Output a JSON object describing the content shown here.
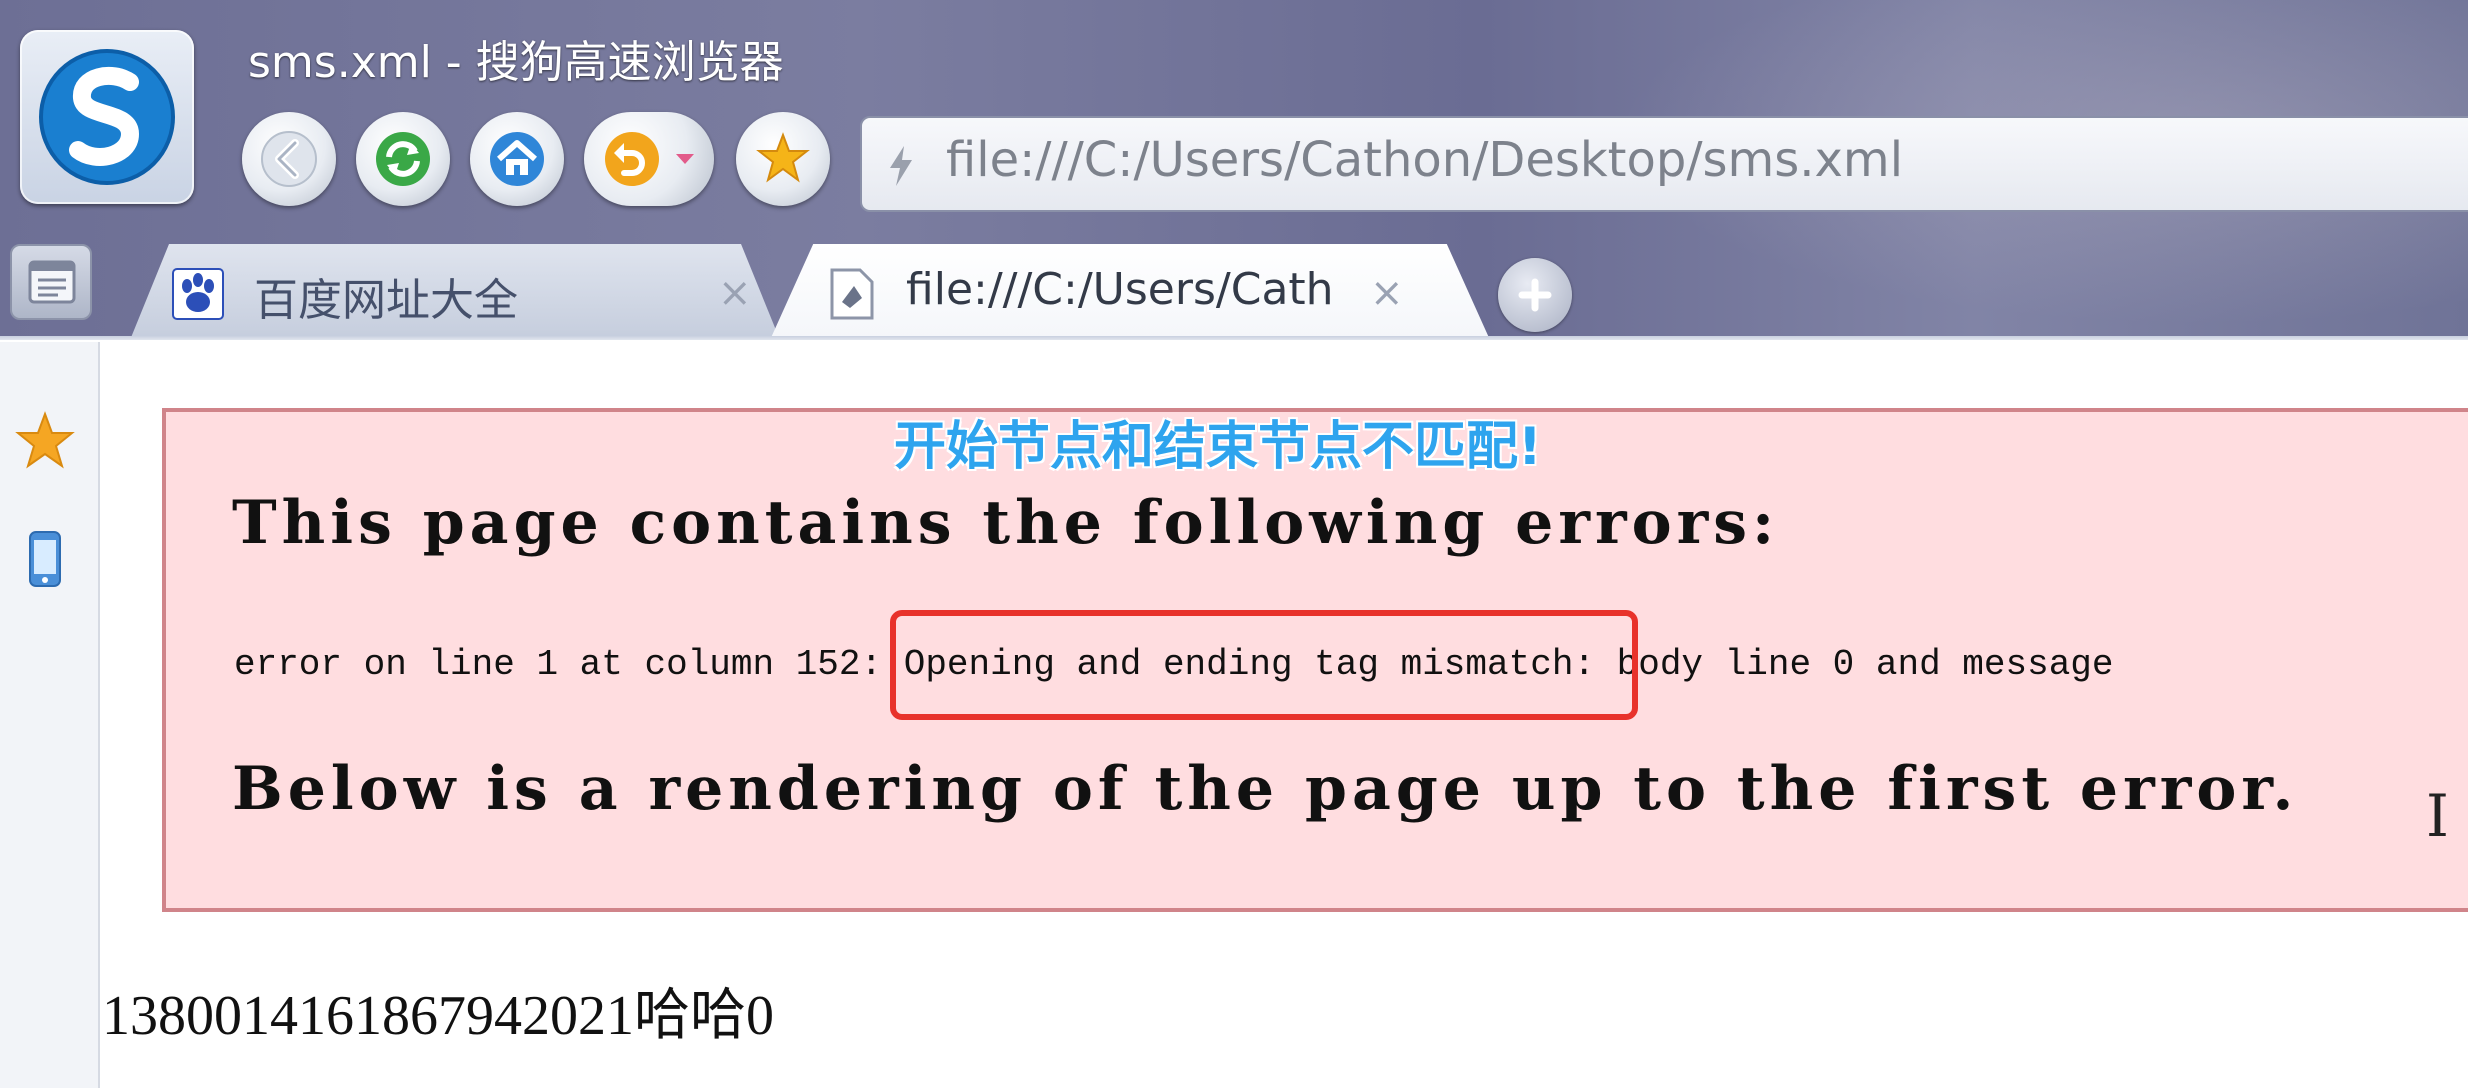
{
  "window": {
    "title": "sms.xml - 搜狗高速浏览器"
  },
  "toolbar": {
    "back_icon": "back-arrow-icon",
    "refresh_icon": "refresh-icon",
    "home_icon": "home-icon",
    "undo_icon": "undo-icon",
    "favorite_icon": "star-icon"
  },
  "address_bar": {
    "url": "file:///C:/Users/Cathon/Desktop/sms.xml"
  },
  "tabs": [
    {
      "label": "百度网址大全",
      "close": "×",
      "active": false
    },
    {
      "label": "file:///C:/Users/Cath",
      "close": "×",
      "active": true
    }
  ],
  "page": {
    "caption": "开始节点和结束节点不匹配!",
    "error_heading": "This page contains the following errors:",
    "error_message": "error on line 1 at column 152: Opening and ending tag mismatch: body line 0 and message",
    "render_heading": "Below is a rendering of the page up to the first error.",
    "rendered_content": "13800141618679420​21哈哈0"
  },
  "colors": {
    "error_background": "#ffdde0",
    "error_border": "#d0848a",
    "highlight": "#e8322b",
    "caption": "#2ea4ee"
  }
}
